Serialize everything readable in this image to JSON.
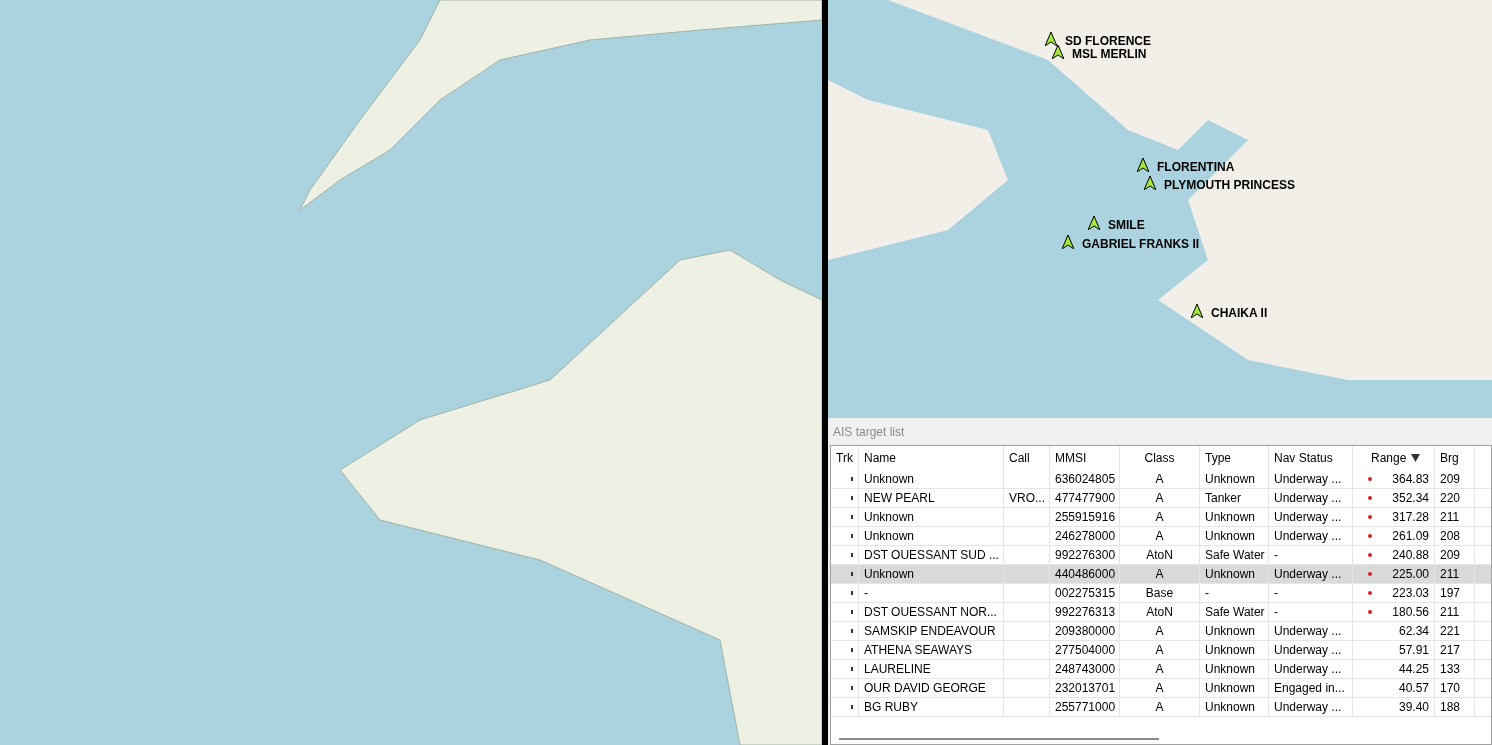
{
  "chart_right": {
    "vessel_labels": [
      "SD FLORENCE",
      "MSL MERLIN",
      "FLORENTINA",
      "PLYMOUTH PRINCESS",
      "SMILE",
      "GABRIEL FRANKS II",
      "CHAIKA II"
    ]
  },
  "ais_list": {
    "title": "AIS target list",
    "columns": [
      {
        "label": "Trk",
        "sorted": false
      },
      {
        "label": "Name",
        "sorted": false
      },
      {
        "label": "Call",
        "sorted": false
      },
      {
        "label": "MMSI",
        "sorted": false
      },
      {
        "label": "Class",
        "sorted": false
      },
      {
        "label": "Type",
        "sorted": false
      },
      {
        "label": "Nav Status",
        "sorted": false
      },
      {
        "label": "Range",
        "sorted": true
      },
      {
        "label": "Brg",
        "sorted": false
      }
    ],
    "rows": [
      {
        "name": "Unknown",
        "call": "",
        "mmsi": "636024805",
        "class": "A",
        "type": "Unknown",
        "nav_status": "Underway ...",
        "range": "364.83",
        "brg": "209",
        "alert": true,
        "selected": false
      },
      {
        "name": "NEW PEARL",
        "call": "VRO...",
        "mmsi": "477477900",
        "class": "A",
        "type": "Tanker",
        "nav_status": "Underway ...",
        "range": "352.34",
        "brg": "220",
        "alert": true,
        "selected": false
      },
      {
        "name": "Unknown",
        "call": "",
        "mmsi": "255915916",
        "class": "A",
        "type": "Unknown",
        "nav_status": "Underway ...",
        "range": "317.28",
        "brg": "211",
        "alert": true,
        "selected": false
      },
      {
        "name": "Unknown",
        "call": "",
        "mmsi": "246278000",
        "class": "A",
        "type": "Unknown",
        "nav_status": "Underway ...",
        "range": "261.09",
        "brg": "208",
        "alert": true,
        "selected": false
      },
      {
        "name": "DST OUESSANT SUD ...",
        "call": "",
        "mmsi": "992276300",
        "class": "AtoN",
        "type": "Safe Water",
        "nav_status": "-",
        "range": "240.88",
        "brg": "209",
        "alert": true,
        "selected": false
      },
      {
        "name": "Unknown",
        "call": "",
        "mmsi": "440486000",
        "class": "A",
        "type": "Unknown",
        "nav_status": "Underway ...",
        "range": "225.00",
        "brg": "211",
        "alert": true,
        "selected": true
      },
      {
        "name": "-",
        "call": "",
        "mmsi": "002275315",
        "class": "Base",
        "type": "-",
        "nav_status": "-",
        "range": "223.03",
        "brg": "197",
        "alert": true,
        "selected": false
      },
      {
        "name": "DST OUESSANT NOR...",
        "call": "",
        "mmsi": "992276313",
        "class": "AtoN",
        "type": "Safe Water",
        "nav_status": "-",
        "range": "180.56",
        "brg": "211",
        "alert": true,
        "selected": false
      },
      {
        "name": "SAMSKIP ENDEAVOUR",
        "call": "",
        "mmsi": "209380000",
        "class": "A",
        "type": "Unknown",
        "nav_status": "Underway ...",
        "range": "62.34",
        "brg": "221",
        "alert": false,
        "selected": false
      },
      {
        "name": "ATHENA SEAWAYS",
        "call": "",
        "mmsi": "277504000",
        "class": "A",
        "type": "Unknown",
        "nav_status": "Underway ...",
        "range": "57.91",
        "brg": "217",
        "alert": false,
        "selected": false
      },
      {
        "name": "LAURELINE",
        "call": "",
        "mmsi": "248743000",
        "class": "A",
        "type": "Unknown",
        "nav_status": "Underway ...",
        "range": "44.25",
        "brg": "133",
        "alert": false,
        "selected": false
      },
      {
        "name": "OUR DAVID GEORGE",
        "call": "",
        "mmsi": "232013701",
        "class": "A",
        "type": "Unknown",
        "nav_status": "Engaged in...",
        "range": "40.57",
        "brg": "170",
        "alert": false,
        "selected": false
      },
      {
        "name": "BG RUBY",
        "call": "",
        "mmsi": "255771000",
        "class": "A",
        "type": "Unknown",
        "nav_status": "Underway ...",
        "range": "39.40",
        "brg": "188",
        "alert": false,
        "selected": false
      }
    ]
  }
}
